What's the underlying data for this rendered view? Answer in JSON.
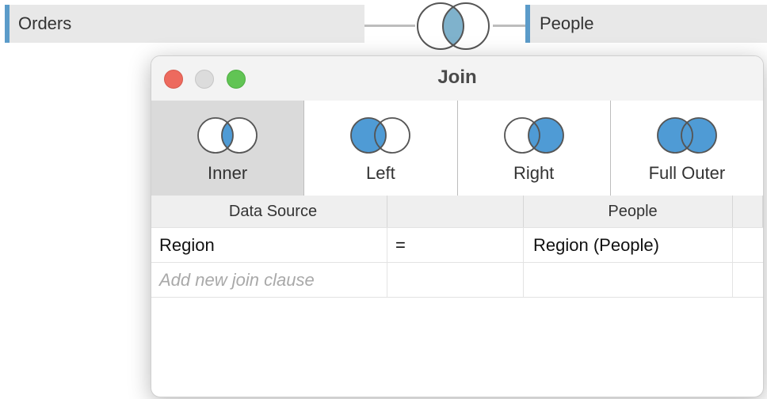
{
  "canvas": {
    "left_table": "Orders",
    "right_table": "People",
    "join_icon": "inner-join-venn-icon"
  },
  "dialog": {
    "title": "Join",
    "join_types": [
      {
        "label": "Inner",
        "icon": "inner-join-icon",
        "selected": true
      },
      {
        "label": "Left",
        "icon": "left-join-icon",
        "selected": false
      },
      {
        "label": "Right",
        "icon": "right-join-icon",
        "selected": false
      },
      {
        "label": "Full Outer",
        "icon": "full-outer-join-icon",
        "selected": false
      }
    ],
    "grid": {
      "headers": [
        "Data Source",
        "",
        "People",
        ""
      ],
      "clauses": [
        {
          "left": "Region",
          "operator": "=",
          "right": "Region (People)"
        }
      ],
      "add_placeholder": "Add new join clause"
    }
  },
  "colors": {
    "accent": "#4f9bd5",
    "pill_border": "#5b9bc9",
    "pill_bg": "#e8e8e8",
    "selected_bg": "#dadada"
  }
}
